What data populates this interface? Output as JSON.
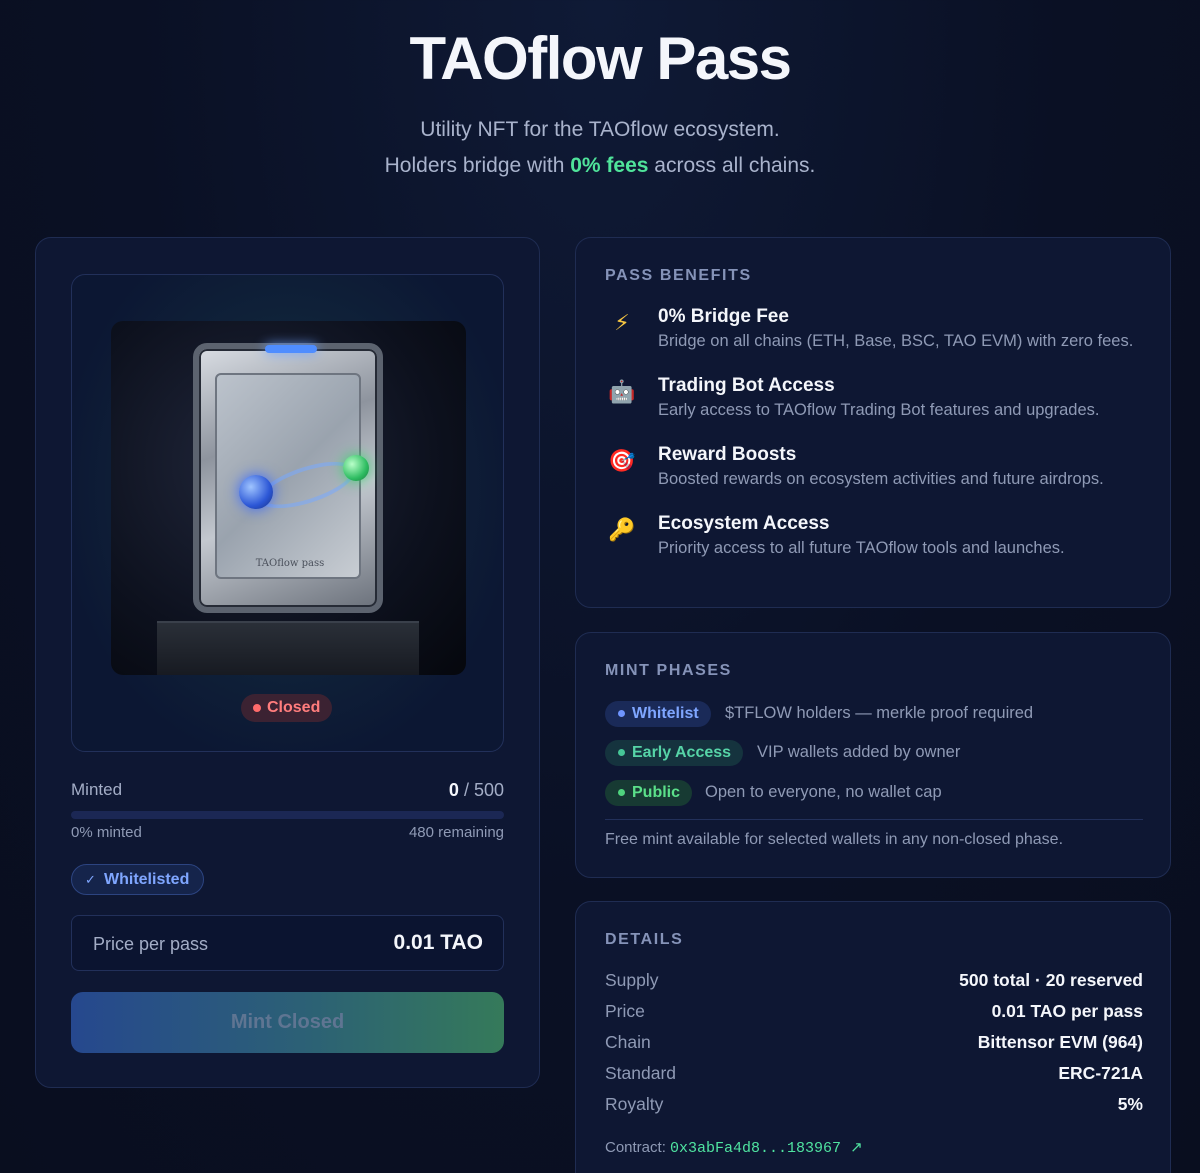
{
  "hero": {
    "title": "TAOflow Pass",
    "subtitle_line1": "Utility NFT for the TAOflow ecosystem.",
    "subtitle_line2_prefix": "Holders bridge with ",
    "subtitle_line2_accent": "0% fees",
    "subtitle_line2_suffix": " across all chains."
  },
  "pass_card": {
    "art_label": "TAOflow pass",
    "status": "Closed",
    "minted_label": "Minted",
    "minted_count": "0",
    "minted_separator": " / ",
    "supply": "500",
    "progress_fraction": 0,
    "progress_percent_text": "0% minted",
    "remaining_text": "480 remaining",
    "whitelist_badge": "Whitelisted",
    "whitelist_check": "✓",
    "price_label": "Price per pass",
    "price_value": "0.01 TAO",
    "mint_button": "Mint Closed"
  },
  "benefits": {
    "title": "PASS BENEFITS",
    "items": [
      {
        "icon": "lightning-icon",
        "glyph": "⚡",
        "title": "0% Bridge Fee",
        "desc": "Bridge on all chains (ETH, Base, BSC, TAO EVM) with zero fees."
      },
      {
        "icon": "robot-icon",
        "glyph": "🤖",
        "title": "Trading Bot Access",
        "desc": "Early access to TAOflow Trading Bot features and upgrades."
      },
      {
        "icon": "target-icon",
        "glyph": "🎯",
        "title": "Reward Boosts",
        "desc": "Boosted rewards on ecosystem activities and future airdrops."
      },
      {
        "icon": "key-icon",
        "glyph": "🔑",
        "title": "Ecosystem Access",
        "desc": "Priority access to all future TAOflow tools and launches."
      }
    ]
  },
  "phases": {
    "title": "MINT PHASES",
    "items": [
      {
        "label": "Whitelist",
        "desc": "$TFLOW holders — merkle proof required"
      },
      {
        "label": "Early Access",
        "desc": "VIP wallets added by owner"
      },
      {
        "label": "Public",
        "desc": "Open to everyone, no wallet cap"
      }
    ],
    "note": "Free mint available for selected wallets in any non-closed phase."
  },
  "details": {
    "title": "DETAILS",
    "rows": [
      {
        "key": "Supply",
        "value": "500 total · 20 reserved"
      },
      {
        "key": "Price",
        "value": "0.01 TAO per pass"
      },
      {
        "key": "Chain",
        "value": "Bittensor EVM (964)"
      },
      {
        "key": "Standard",
        "value": "ERC-721A"
      },
      {
        "key": "Royalty",
        "value": "5%"
      }
    ],
    "contract_label": "Contract: ",
    "contract_address": "0x3abFa4d8...183967",
    "contract_arrow": "↗"
  },
  "colors": {
    "accent_green": "#4fe39a",
    "accent_blue": "#7fa6ff",
    "closed_red": "#ff7d7d",
    "background": "#0a1024",
    "card": "#0e1733"
  }
}
